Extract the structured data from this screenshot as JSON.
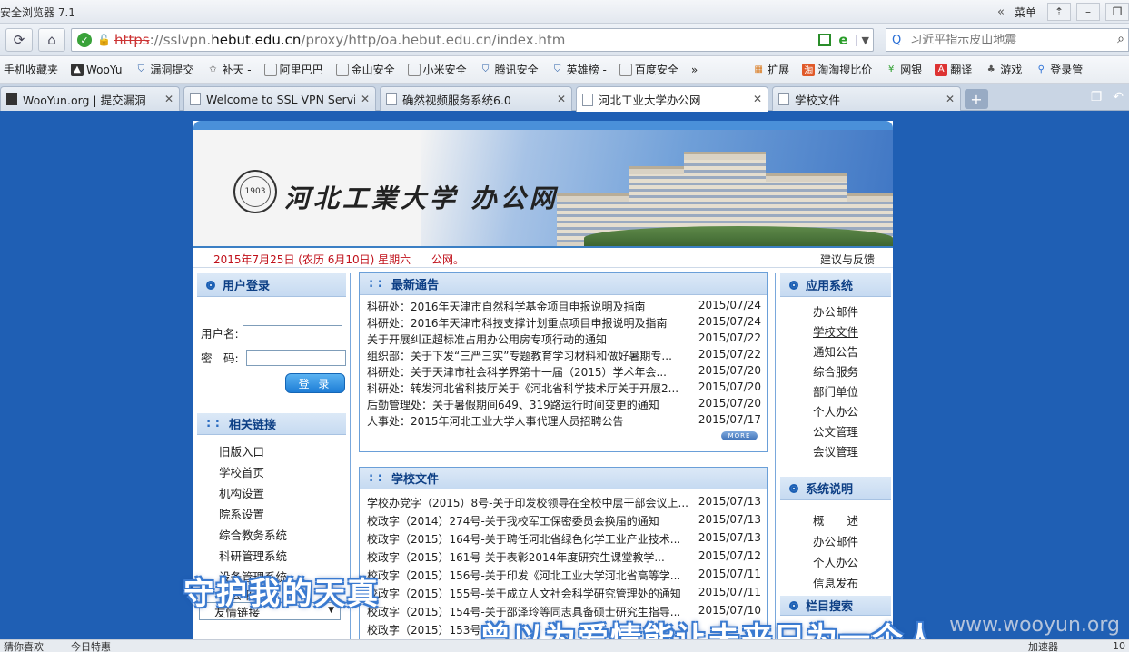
{
  "browser": {
    "title": "安全浏览器 7.1",
    "menu_label": "菜单",
    "url_proto": "https",
    "url_host_prefix": "://sslvpn.",
    "url_host": "hebut.edu.cn",
    "url_path": "/proxy/http/oa.hebut.edu.cn/index.htm",
    "search_placeholder": "习近平指示皮山地震",
    "bookmarks": [
      {
        "label": "手机收藏夹",
        "icon": "mobile-icon"
      },
      {
        "label": "WooYu",
        "icon": "wooyun-icon"
      },
      {
        "label": "漏洞提交",
        "icon": "shield-icon"
      },
      {
        "label": "补天 -",
        "icon": "star-icon"
      },
      {
        "label": "阿里巴巴",
        "icon": "page-icon"
      },
      {
        "label": "金山安全",
        "icon": "page-icon"
      },
      {
        "label": "小米安全",
        "icon": "page-icon"
      },
      {
        "label": "腾讯安全",
        "icon": "shield-icon"
      },
      {
        "label": "英雄榜 -",
        "icon": "shield-icon"
      },
      {
        "label": "百度安全",
        "icon": "page-icon"
      }
    ],
    "bookmarks_more": "»",
    "toolbar_right": [
      {
        "label": "扩展",
        "icon": "grid-icon"
      },
      {
        "label": "淘淘搜比价",
        "icon": "tao-icon"
      },
      {
        "label": "网银",
        "icon": "yen-icon"
      },
      {
        "label": "翻译",
        "icon": "translate-icon"
      },
      {
        "label": "游戏",
        "icon": "game-icon"
      },
      {
        "label": "登录管",
        "icon": "login-icon"
      }
    ],
    "tabs": [
      {
        "label": "WooYun.org | 提交漏洞"
      },
      {
        "label": "Welcome to SSL VPN Service"
      },
      {
        "label": "确然视频服务系统6.0"
      },
      {
        "label": "河北工业大学办公网"
      },
      {
        "label": "学校文件"
      }
    ],
    "new_tab": "+",
    "status_left": "猜你喜欢",
    "status_today": "今日特惠",
    "status_right": "加速器",
    "status_num": "10"
  },
  "site": {
    "seal_text": "1903",
    "name": "河北工業大学 办公网",
    "date_text": "2015年7月25日 (农历  6月10日)  星期六",
    "marquee_text": "公网。",
    "feedback": "建议与反馈"
  },
  "login": {
    "header": "用户登录",
    "username_label": "用户名:",
    "password_label": "密　码:",
    "submit": "登 录"
  },
  "links": {
    "header": "相关链接",
    "items": [
      "旧版入口",
      "学校首页",
      "机构设置",
      "院系设置",
      "综合教务系统",
      "科研管理系统",
      "设备管理系统",
      "办公平台"
    ],
    "select_label": "友情链接"
  },
  "news": {
    "header": "最新通告",
    "more": "MORE",
    "rows": [
      {
        "title": "科研处：2016年天津市自然科学基金项目申报说明及指南",
        "date": "2015/07/24"
      },
      {
        "title": "科研处：2016年天津市科技支撑计划重点项目申报说明及指南",
        "date": "2015/07/24"
      },
      {
        "title": "关于开展纠正超标准占用办公用房专项行动的通知",
        "date": "2015/07/22"
      },
      {
        "title": "组织部：关于下发“三严三实”专题教育学习材料和做好暑期专...",
        "date": "2015/07/22"
      },
      {
        "title": "科研处：关于天津市社会科学界第十一届（2015）学术年会...",
        "date": "2015/07/20"
      },
      {
        "title": "科研处：转发河北省科技厅关于《河北省科学技术厅关于开展2...",
        "date": "2015/07/20"
      },
      {
        "title": "后勤管理处：关于暑假期间649、319路运行时间变更的通知",
        "date": "2015/07/20"
      },
      {
        "title": "人事处：2015年河北工业大学人事代理人员招聘公告",
        "date": "2015/07/17"
      }
    ]
  },
  "files": {
    "header": "学校文件",
    "rows": [
      {
        "title": "学校办党字（2015）8号-关于印发校领导在全校中层干部会议上...",
        "date": "2015/07/13"
      },
      {
        "title": "校政字（2014）274号-关于我校军工保密委员会换届的通知",
        "date": "2015/07/13"
      },
      {
        "title": "校政字（2015）164号-关于聘任河北省绿色化学工业产业技术...",
        "date": "2015/07/13"
      },
      {
        "title": "校政字（2015）161号-关于表彰2014年度研究生课堂教学...",
        "date": "2015/07/12"
      },
      {
        "title": "校政字（2015）156号-关于印发《河北工业大学河北省高等学...",
        "date": "2015/07/11"
      },
      {
        "title": "校政字（2015）155号-关于成立人文社会科学研究管理处的通知",
        "date": "2015/07/11"
      },
      {
        "title": "校政字（2015）154号-关于邵泽玲等同志具备硕士研究生指导...",
        "date": "2015/07/10"
      },
      {
        "title": "校政字（2015）153号-",
        "date": ""
      }
    ]
  },
  "apps": {
    "header": "应用系统",
    "items": [
      "办公邮件",
      "学校文件",
      "通知公告",
      "综合服务",
      "部门单位",
      "个人办公",
      "公文管理",
      "会议管理"
    ]
  },
  "sys": {
    "header": "系统说明",
    "items": [
      "概　　述",
      "办公邮件",
      "个人办公",
      "信息发布"
    ]
  },
  "colsearch": {
    "header": "栏目搜索"
  },
  "overlay": {
    "lyric1": "守护我的天真",
    "lyric2": "曾以为爱情能让未来只为一个人",
    "watermark": "www.wooyun.org"
  },
  "colors": {
    "page_bg": "#1f5fb4",
    "header_blue": "#0d3f85",
    "date_red": "#c0101a"
  }
}
